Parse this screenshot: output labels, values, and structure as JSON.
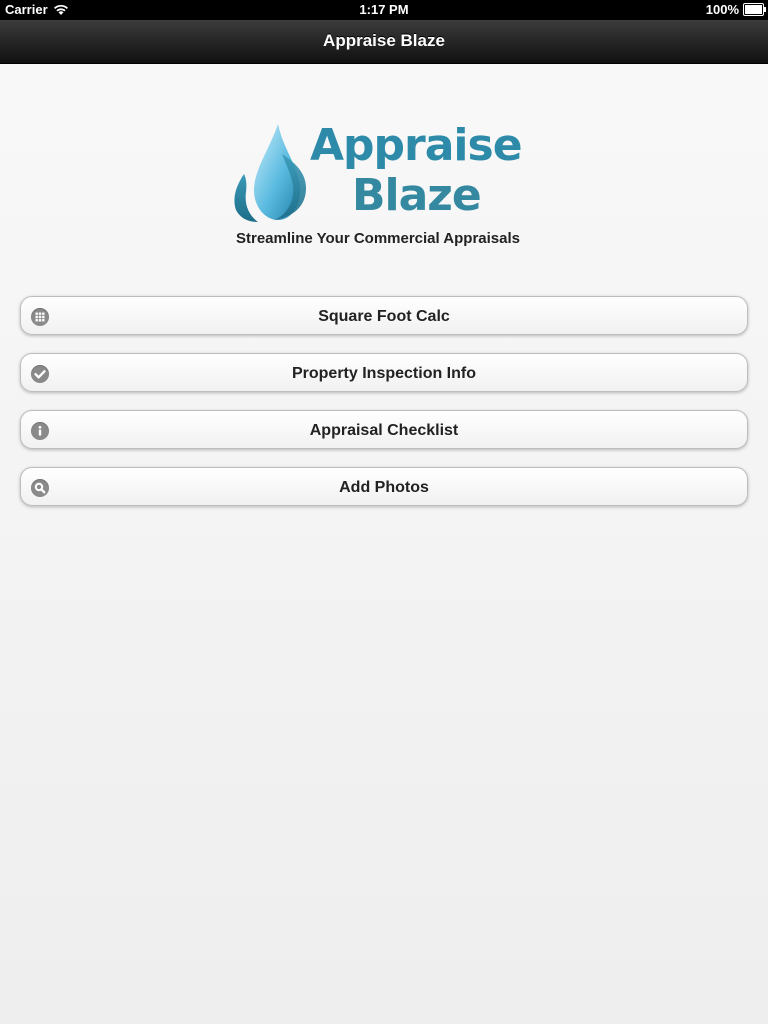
{
  "status_bar": {
    "carrier": "Carrier",
    "time": "1:17 PM",
    "battery": "100%"
  },
  "navbar": {
    "title": "Appraise Blaze"
  },
  "logo": {
    "line1": "Appraise",
    "line2": "Blaze",
    "tagline": "Streamline Your Commercial Appraisals"
  },
  "menu": {
    "items": [
      {
        "label": "Square Foot Calc",
        "icon": "grid-icon"
      },
      {
        "label": "Property Inspection Info",
        "icon": "check-icon"
      },
      {
        "label": "Appraisal Checklist",
        "icon": "info-icon"
      },
      {
        "label": "Add Photos",
        "icon": "search-icon"
      }
    ]
  },
  "colors": {
    "brand": "#2d8aa8",
    "navbar": "#1e1e1e",
    "icon": "#8a8a8a"
  }
}
